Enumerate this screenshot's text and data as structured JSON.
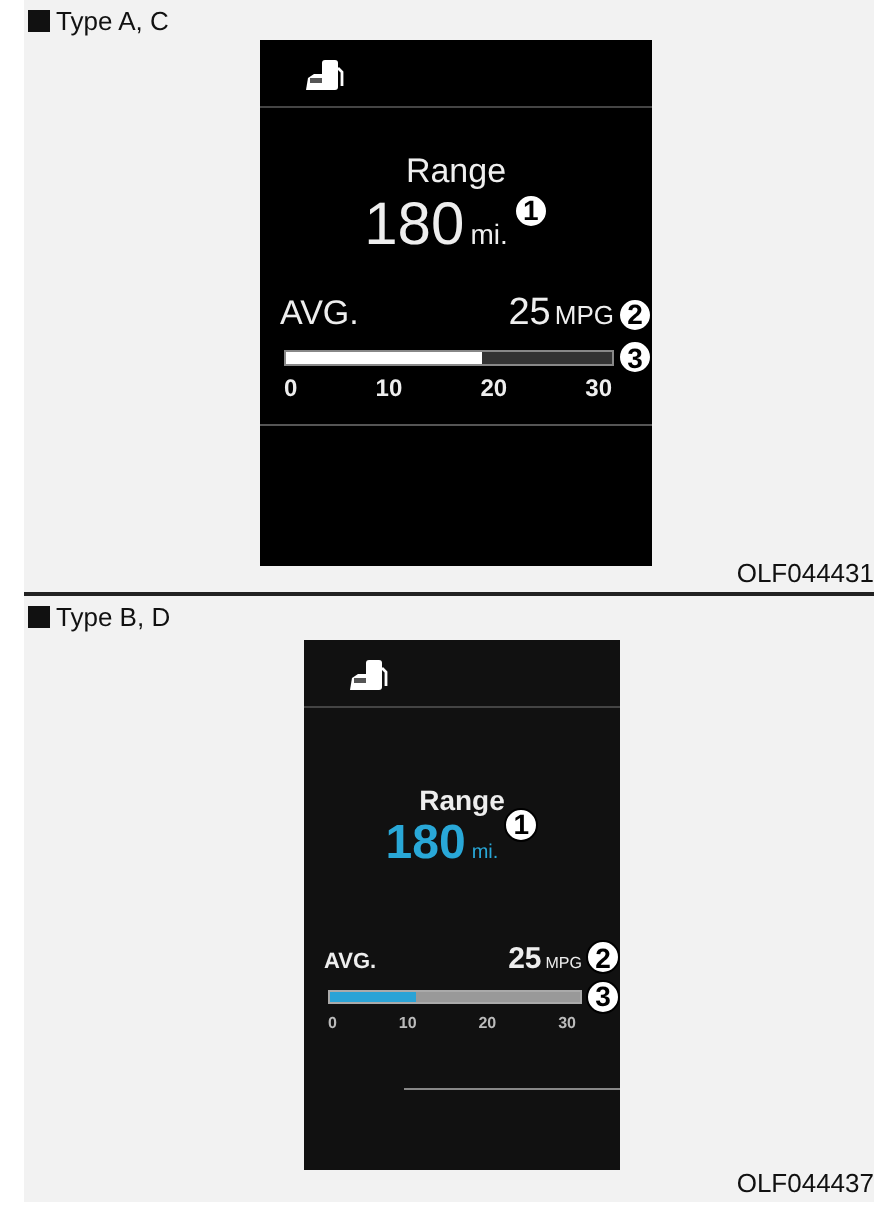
{
  "panels": [
    {
      "label": "Type A, C",
      "kind": "white",
      "range_label": "Range",
      "range_value": "180",
      "range_unit": "mi.",
      "avg_label": "AVG.",
      "avg_value": "25",
      "avg_unit": "MPG",
      "level": 0.6,
      "ticks": [
        "0",
        "10",
        "20",
        "30"
      ],
      "callouts": [
        "1",
        "2",
        "3"
      ],
      "code": "OLF044431"
    },
    {
      "label": "Type B, D",
      "kind": "blue",
      "range_label": "Range",
      "range_value": "180",
      "range_unit": "mi.",
      "avg_label": "AVG.",
      "avg_value": "25",
      "avg_unit": "MPG",
      "level": 0.34,
      "ticks": [
        "0",
        "10",
        "20",
        "30"
      ],
      "callouts": [
        "1",
        "2",
        "3"
      ],
      "code": "OLF044437"
    }
  ]
}
